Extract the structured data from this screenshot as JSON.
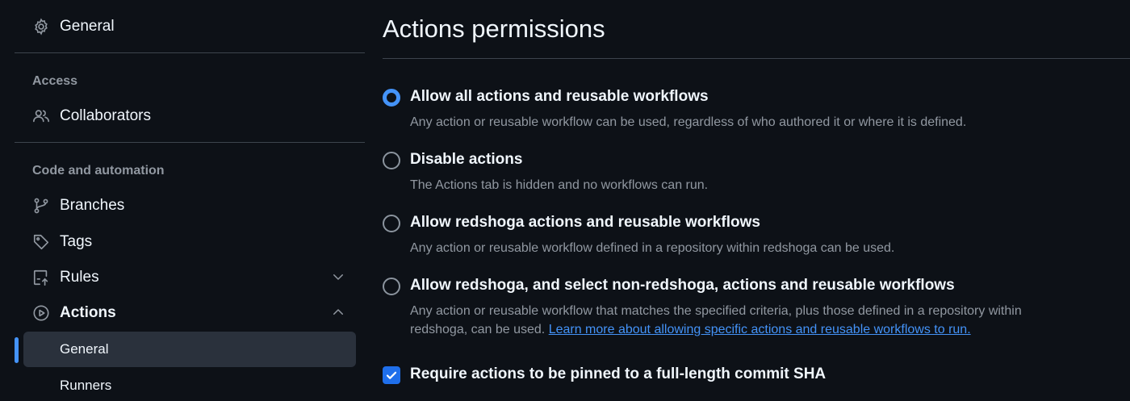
{
  "sidebar": {
    "general_label": "General",
    "access_heading": "Access",
    "collaborators_label": "Collaborators",
    "code_heading": "Code and automation",
    "branches_label": "Branches",
    "tags_label": "Tags",
    "rules_label": "Rules",
    "actions_label": "Actions",
    "actions_sub": {
      "general_label": "General",
      "runners_label": "Runners"
    },
    "icons": [
      "gear-icon",
      "people-icon",
      "git-branch-icon",
      "tag-icon",
      "rules-icon",
      "play-icon",
      "chevron-down-icon",
      "chevron-up-icon"
    ]
  },
  "main": {
    "title": "Actions permissions",
    "options": [
      {
        "label": "Allow all actions and reusable workflows",
        "description": "Any action or reusable workflow can be used, regardless of who authored it or where it is defined.",
        "checked": true
      },
      {
        "label": "Disable actions",
        "description": "The Actions tab is hidden and no workflows can run.",
        "checked": false
      },
      {
        "label": "Allow redshoga actions and reusable workflows",
        "description": "Any action or reusable workflow defined in a repository within redshoga can be used.",
        "checked": false
      },
      {
        "label": "Allow redshoga, and select non-redshoga, actions and reusable workflows",
        "description": "Any action or reusable workflow that matches the specified criteria, plus those defined in a repository within redshoga, can be used.",
        "link_text": "Learn more about allowing specific actions and reusable workflows to run.",
        "checked": false
      }
    ],
    "pin_sha_label": "Require actions to be pinned to a full-length commit SHA",
    "pin_sha_checked": true
  },
  "colors": {
    "background": "#0d1117",
    "accent": "#4493f8",
    "text": "#f0f6fc",
    "muted": "#9198a1",
    "active_item_bg": "#2a313c"
  }
}
